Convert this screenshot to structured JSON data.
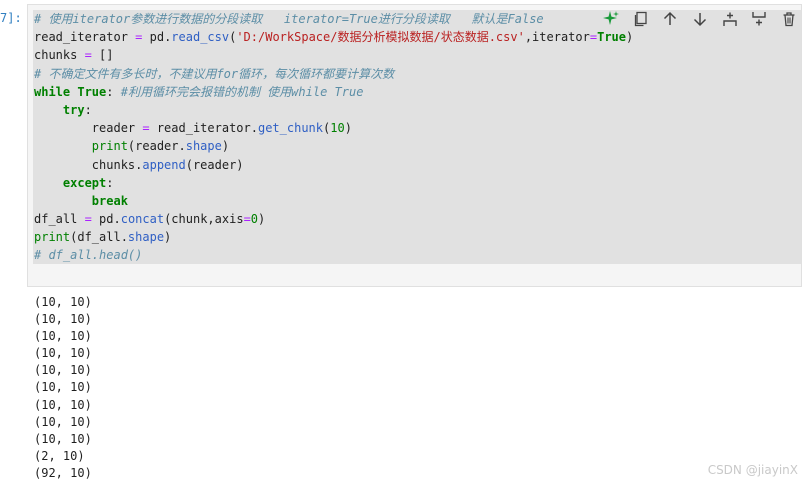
{
  "cell": {
    "prompt": "7]:",
    "code_lines": [
      [
        {
          "t": "# 使用iterator参数进行数据的分段读取   iterator=True进行分段读取   默认是False",
          "c": "cm"
        }
      ],
      [
        {
          "t": "read_iterator "
        },
        {
          "t": "=",
          "c": "op"
        },
        {
          "t": " pd."
        },
        {
          "t": "read_csv",
          "c": "fn"
        },
        {
          "t": "("
        },
        {
          "t": "'D:/WorkSpace/数据分析模拟数据/状态数据.csv'",
          "c": "st"
        },
        {
          "t": ",iterator"
        },
        {
          "t": "=",
          "c": "op"
        },
        {
          "t": "True",
          "c": "kw"
        },
        {
          "t": ")"
        }
      ],
      [
        {
          "t": "chunks "
        },
        {
          "t": "=",
          "c": "op"
        },
        {
          "t": " []"
        }
      ],
      [
        {
          "t": "# 不确定文件有多长时，不建议用for循环，每次循环都要计算次数",
          "c": "cm"
        }
      ],
      [
        {
          "t": "while",
          "c": "kw"
        },
        {
          "t": " "
        },
        {
          "t": "True",
          "c": "kw"
        },
        {
          "t": ": "
        },
        {
          "t": "#利用循环完会报错的机制 使用while True",
          "c": "cm"
        }
      ],
      [
        {
          "t": "    "
        },
        {
          "t": "try",
          "c": "kw"
        },
        {
          "t": ":"
        }
      ],
      [
        {
          "t": "        reader "
        },
        {
          "t": "=",
          "c": "op"
        },
        {
          "t": " read_iterator."
        },
        {
          "t": "get_chunk",
          "c": "fn"
        },
        {
          "t": "("
        },
        {
          "t": "10",
          "c": "nm"
        },
        {
          "t": ")"
        }
      ],
      [
        {
          "t": "        "
        },
        {
          "t": "print",
          "c": "nm"
        },
        {
          "t": "(reader."
        },
        {
          "t": "shape",
          "c": "fn"
        },
        {
          "t": ")"
        }
      ],
      [
        {
          "t": "        chunks."
        },
        {
          "t": "append",
          "c": "fn"
        },
        {
          "t": "(reader)"
        }
      ],
      [
        {
          "t": "    "
        },
        {
          "t": "except",
          "c": "kw"
        },
        {
          "t": ":"
        }
      ],
      [
        {
          "t": "        "
        },
        {
          "t": "break",
          "c": "kw"
        }
      ],
      [
        {
          "t": "df_all "
        },
        {
          "t": "=",
          "c": "op"
        },
        {
          "t": " pd."
        },
        {
          "t": "concat",
          "c": "fn"
        },
        {
          "t": "(chunk,axis"
        },
        {
          "t": "=",
          "c": "op"
        },
        {
          "t": "0",
          "c": "nm"
        },
        {
          "t": ")"
        }
      ],
      [
        {
          "t": "print",
          "c": "nm"
        },
        {
          "t": "(df_all."
        },
        {
          "t": "shape",
          "c": "fn"
        },
        {
          "t": ")"
        }
      ],
      [
        {
          "t": "# df_all.head()",
          "c": "cm"
        }
      ]
    ]
  },
  "toolbar": {
    "colors": {
      "sparkle": "#1a9a3a",
      "icon": "#444444"
    },
    "buttons": [
      {
        "name": "generate-sparkle-icon"
      },
      {
        "name": "copy-cell-icon"
      },
      {
        "name": "move-up-icon"
      },
      {
        "name": "move-down-icon"
      },
      {
        "name": "insert-above-icon"
      },
      {
        "name": "insert-below-icon"
      },
      {
        "name": "delete-cell-icon"
      }
    ]
  },
  "output": {
    "lines": [
      "(10, 10)",
      "(10, 10)",
      "(10, 10)",
      "(10, 10)",
      "(10, 10)",
      "(10, 10)",
      "(10, 10)",
      "(10, 10)",
      "(10, 10)",
      "(2, 10)",
      "(92, 10)"
    ]
  },
  "watermark": "CSDN @jiayinX"
}
